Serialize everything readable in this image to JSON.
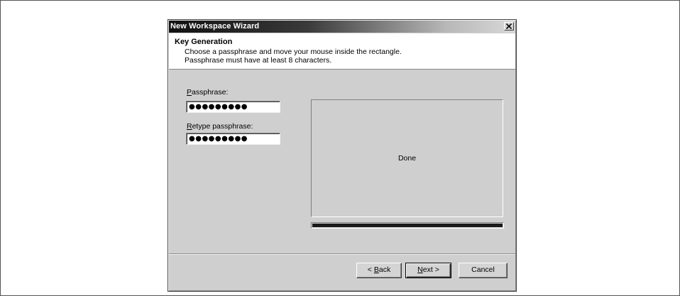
{
  "window": {
    "title": "New Workspace Wizard",
    "close_label": "×"
  },
  "header": {
    "title": "Key Generation",
    "line1": "Choose a passphrase and move your mouse inside the rectangle.",
    "line2": "Passphrase must have at least 8 characters."
  },
  "form": {
    "passphrase_label_mnemonic": "P",
    "passphrase_label_rest": "assphrase:",
    "passphrase_value": "●●●●●●●●●",
    "retype_label_mnemonic": "R",
    "retype_label_rest": "etype passphrase:",
    "retype_value": "●●●●●●●●●"
  },
  "entropy": {
    "status_text": "Done",
    "progress_percent": 100
  },
  "buttons": {
    "back_prefix": "< ",
    "back_mnemonic": "B",
    "back_rest": "ack",
    "next_mnemonic": "N",
    "next_rest": "ext >",
    "cancel": "Cancel"
  },
  "colors": {
    "dialog_bg": "#cfcfcf",
    "header_bg": "#ffffff",
    "progress_fill": "#1a1a1a"
  }
}
